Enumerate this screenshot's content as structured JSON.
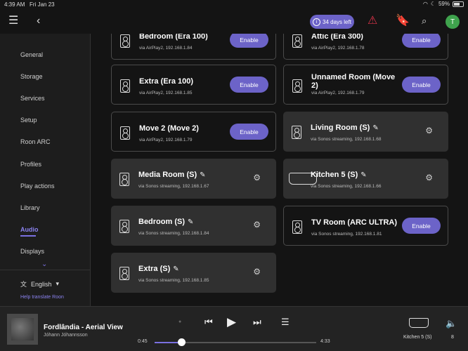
{
  "status": {
    "time": "4:39 AM",
    "date": "Fri Jan 23",
    "battery": "59%"
  },
  "topbar": {
    "trial_label": "34 days left",
    "avatar_letter": "T"
  },
  "sidebar": {
    "items": [
      "General",
      "Storage",
      "Services",
      "Setup",
      "Roon ARC",
      "Profiles",
      "Play actions",
      "Library",
      "Audio",
      "Displays"
    ],
    "active": "Audio",
    "language": "English",
    "help_link": "Help translate Roon"
  },
  "cards": [
    {
      "title": "Bedroom (Era 100)",
      "sub": "via AirPlay2, 192.168.1.84",
      "action": "Enable"
    },
    {
      "title": "Attic (Era 300)",
      "sub": "via AirPlay2, 192.168.1.78",
      "action": "Enable"
    },
    {
      "title": "Extra (Era 100)",
      "sub": "via AirPlay2, 192.168.1.85",
      "action": "Enable"
    },
    {
      "title": "Unnamed Room (Move 2)",
      "sub": "via AirPlay2, 192.168.1.79",
      "action": "Enable"
    },
    {
      "title": "Move 2 (Move 2)",
      "sub": "via AirPlay2, 192.168.1.79",
      "action": "Enable"
    },
    {
      "title": "Living Room (S)",
      "sub": "via Sonos streaming, 192.168.1.68"
    },
    {
      "title": "Media Room (S)",
      "sub": "via Sonos streaming, 192.168.1.67"
    },
    {
      "title": "Kitchen 5 (S)",
      "sub": "via Sonos streaming, 192.168.1.66"
    },
    {
      "title": "Bedroom (S)",
      "sub": "via Sonos streaming, 192.168.1.84"
    },
    {
      "title": "TV Room (ARC ULTRA)",
      "sub": "via Sonos streaming, 192.168.1.81",
      "action": "Enable"
    },
    {
      "title": "Extra (S)",
      "sub": "via Sonos streaming, 192.168.1.85"
    }
  ],
  "player": {
    "track": "Fordlândia - Aerial View",
    "artist": "Jóhann Jóhannsson",
    "elapsed": "0:45",
    "duration": "4:33",
    "progress": 0.165,
    "zone": "Kitchen 5 (S)",
    "volume": "8"
  }
}
